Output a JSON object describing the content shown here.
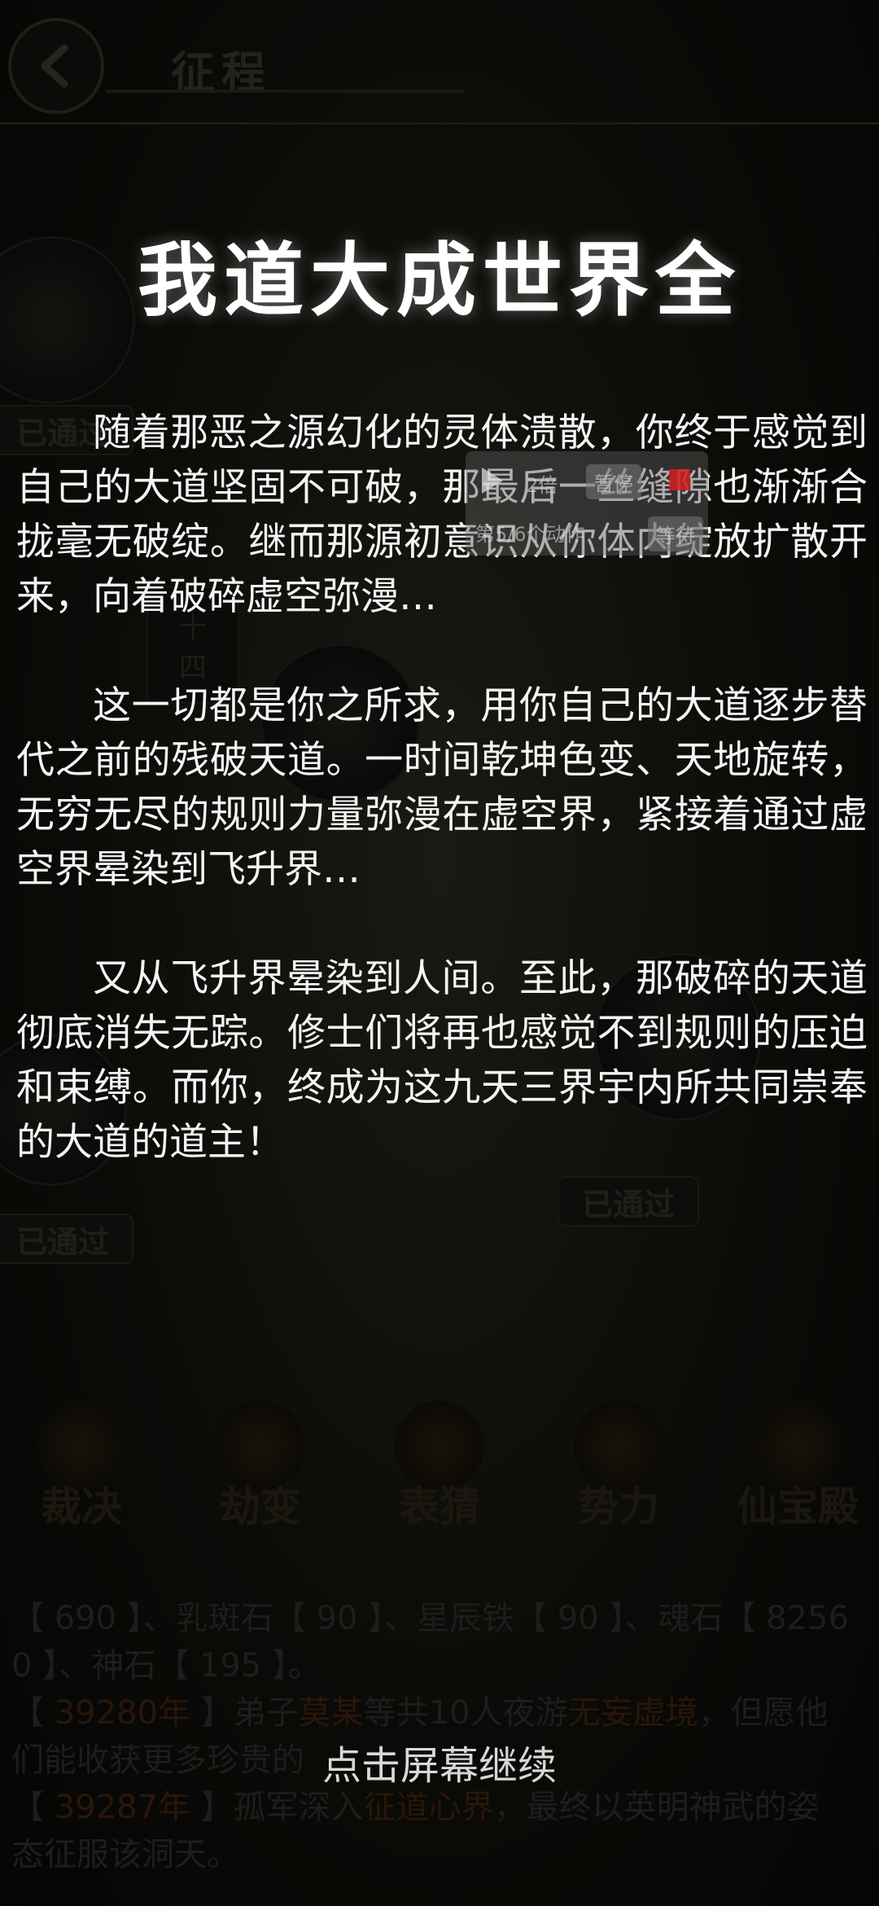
{
  "header": {
    "back_icon": "chevron-left-icon",
    "title": "征程"
  },
  "background": {
    "badges": [
      "已通过",
      "已通过",
      "已通过"
    ],
    "node_label_top": "十",
    "node_label_bottom": "四"
  },
  "story": {
    "title": "我道大成世界全",
    "paragraphs": [
      "随着那恶之源幻化的灵体溃散，你终于感觉到自己的大道坚固不可破，那最后一丝缝隙也渐渐合拢毫无破绽。继而那源初意识从你体内绽放扩散开来，向着破碎虚空弥漫…",
      "这一切都是你之所求，用你自己的大道逐步替代之前的残破天道。一时间乾坤色变、天地旋转，无穷无尽的规则力量弥漫在虚空界，紧接着通过虚空界晕染到飞升界…",
      "又从飞升界晕染到人间。至此，那破碎的天道彻底消失无踪。修士们将再也感觉不到规则的压迫和束缚。而你，终成为这九天三界宇内所共同崇奉的大道的道主！"
    ],
    "continue_hint": "点击屏幕继续"
  },
  "bottom_nav": {
    "items": [
      {
        "label": "裁决",
        "icon": "judgement-icon"
      },
      {
        "label": "劫变",
        "icon": "tribulation-icon"
      },
      {
        "label": "表猜",
        "icon": "mask-icon"
      },
      {
        "label": "势力",
        "icon": "faction-icon"
      },
      {
        "label": "仙宝殿",
        "icon": "treasure-hall-icon"
      }
    ]
  },
  "log": {
    "line1": "【 690 】、乳斑石【 90 】、星辰铁【 90 】、魂石【 8256",
    "line2": "0 】、神石【 195 】。",
    "line3_pre": "【 ",
    "line3_year": "39280年",
    "line3_mid": " 】弟子",
    "line3_name": "莫某",
    "line3_post1": "等共10人夜游",
    "line3_place": "无妄虚境",
    "line3_post2": "，但愿他",
    "line4": "们能收获更多珍贵的",
    "line5_pre": "【 ",
    "line5_year": "39287年",
    "line5_mid": " 】孤军深入",
    "line5_place": "征道心界",
    "line5_post": "，最终以英明神武的姿",
    "line6": "态征服该洞天。"
  },
  "recorder": {
    "speed": "2倍",
    "pause_label": "暂停",
    "progress": "第5/6个动作",
    "wait_label": "等待"
  }
}
